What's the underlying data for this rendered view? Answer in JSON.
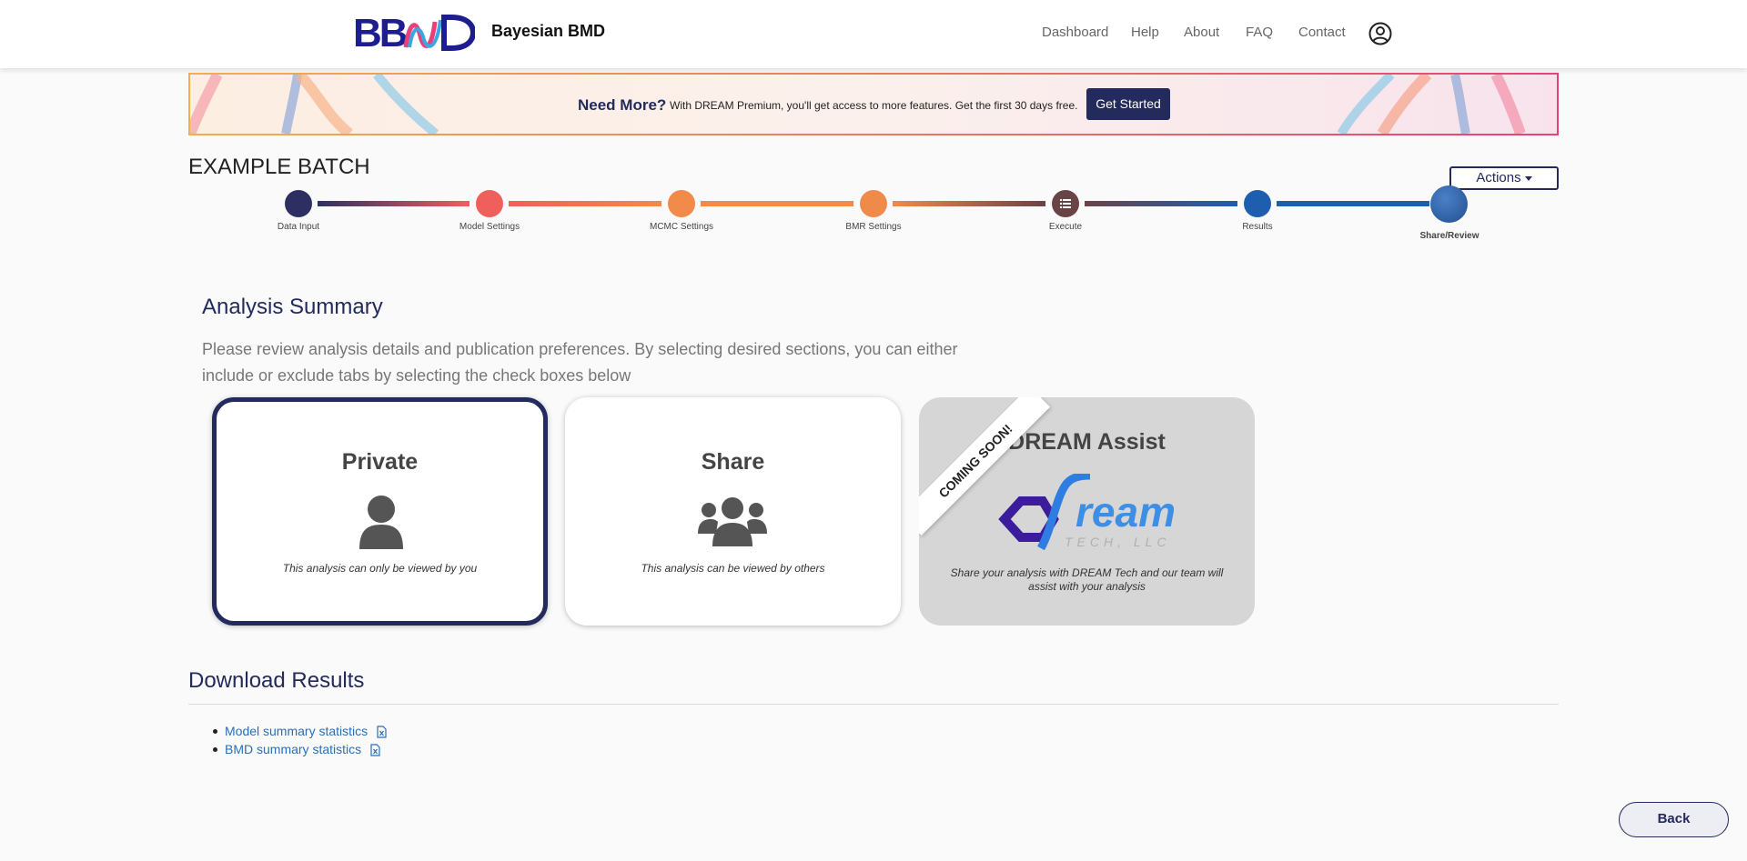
{
  "header": {
    "app_title": "Bayesian BMD",
    "nav": [
      "Dashboard",
      "Help",
      "About",
      "FAQ",
      "Contact"
    ],
    "user_icon": "user-circle-icon"
  },
  "promo": {
    "title": "Need More?",
    "text": "With DREAM Premium, you'll get access to more features. Get the first 30 days free.",
    "button": "Get Started"
  },
  "batch": {
    "title": "EXAMPLE BATCH",
    "actions_label": "Actions"
  },
  "steps": [
    {
      "label": "Data Input",
      "color": "#2d2f63"
    },
    {
      "label": "Model Settings",
      "color": "#ef5f5b"
    },
    {
      "label": "MCMC Settings",
      "color": "#f28a49"
    },
    {
      "label": "BMR Settings",
      "color": "#f08a4b"
    },
    {
      "label": "Execute",
      "color": "#6a4346",
      "icon": "list-icon"
    },
    {
      "label": "Results",
      "color": "#1f5eaf"
    },
    {
      "label": "Share/Review",
      "color": "#2a5fa8"
    }
  ],
  "summary": {
    "title": "Analysis Summary",
    "description": "Please review analysis details and publication preferences. By selecting desired sections, you can either include or exclude tabs by selecting the check boxes below",
    "cards": [
      {
        "title": "Private",
        "desc": "This analysis can only be viewed by you",
        "icon": "user-icon",
        "selected": true
      },
      {
        "title": "Share",
        "desc": "This analysis can be viewed by others",
        "icon": "users-icon",
        "selected": false
      },
      {
        "title": "DREAM Assist",
        "desc": "Share your analysis with DREAM Tech and our team will assist with your analysis",
        "ribbon": "COMING SOON!",
        "logo_text": "ream",
        "logo_sub": "TECH, LLC",
        "disabled": true
      }
    ]
  },
  "downloads": {
    "title": "Download Results",
    "items": [
      "Model summary statistics",
      "BMD summary statistics"
    ]
  },
  "footer": {
    "back": "Back"
  }
}
